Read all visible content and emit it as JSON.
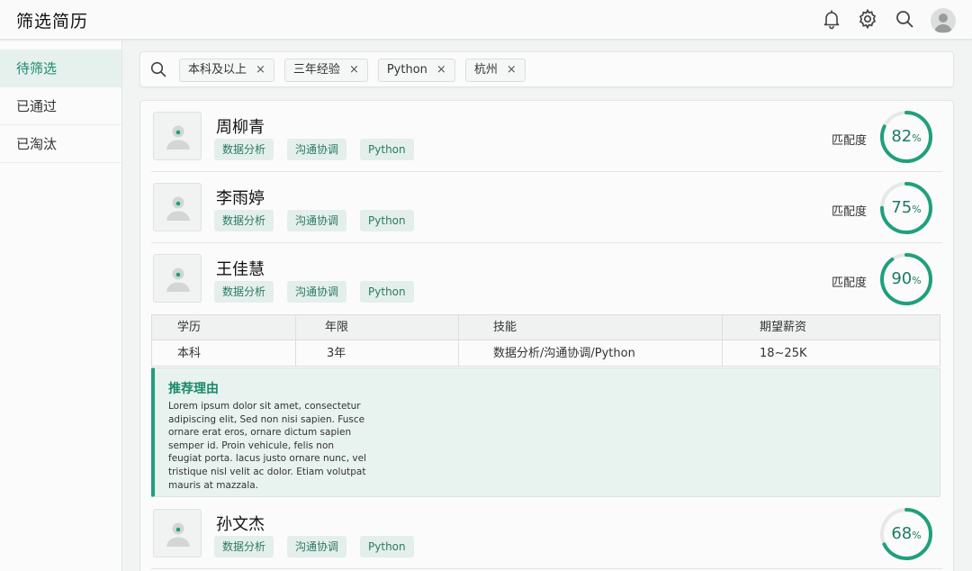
{
  "app": {
    "title": "筛选简历"
  },
  "header": {
    "icons": [
      "bell-icon",
      "gear-icon",
      "search-icon",
      "user-avatar"
    ]
  },
  "sidebar": {
    "items": [
      {
        "label": "待筛选",
        "active": true
      },
      {
        "label": "已通过",
        "active": false
      },
      {
        "label": "已淘汰",
        "active": false
      }
    ]
  },
  "filters": {
    "chips": [
      {
        "label": "本科及以上",
        "remove": "×"
      },
      {
        "label": "三年经验",
        "remove": "×"
      },
      {
        "label": "Python",
        "remove": "×"
      },
      {
        "label": "杭州",
        "remove": "×"
      }
    ]
  },
  "candidates": [
    {
      "name": "周柳青",
      "tags": [
        "数据分析",
        "沟通协调",
        "Python"
      ],
      "match_label": "匹配度",
      "match": 82,
      "unit": "%"
    },
    {
      "name": "李雨婷",
      "tags": [
        "数据分析",
        "沟通协调",
        "Python"
      ],
      "match_label": "匹配度",
      "match": 75,
      "unit": "%"
    },
    {
      "name": "王佳慧",
      "tags": [
        "数据分析",
        "沟通协调",
        "Python"
      ],
      "match_label": "匹配度",
      "match": 90,
      "unit": "%"
    },
    {
      "name": "孙文杰",
      "tags": [
        "数据分析",
        "沟通协调",
        "Python"
      ],
      "match_label": "",
      "match": 68,
      "unit": "%"
    }
  ],
  "detail": {
    "headers": [
      "学历",
      "年限",
      "技能",
      "期望薪资"
    ],
    "values": [
      "本科",
      "3年",
      "数据分析/沟通协调/Python",
      "18~25K"
    ]
  },
  "reason": {
    "title": "推荐理由",
    "body": "Lorem ipsum dolor sit amet, consectetur adipiscing elit, Sed non nisi sapien. Fusce ornare erat eros, ornare dictum sapien semper id. Proin vehicule, felis non feugiat porta. lacus justo ornare nunc, vel tristique nisl velit ac dolor. Etiam volutpat mauris at mazzala."
  },
  "colors": {
    "accent": "#1fa07c",
    "tag_bg": "#e4efec",
    "active_bg": "#e6f1ee"
  }
}
